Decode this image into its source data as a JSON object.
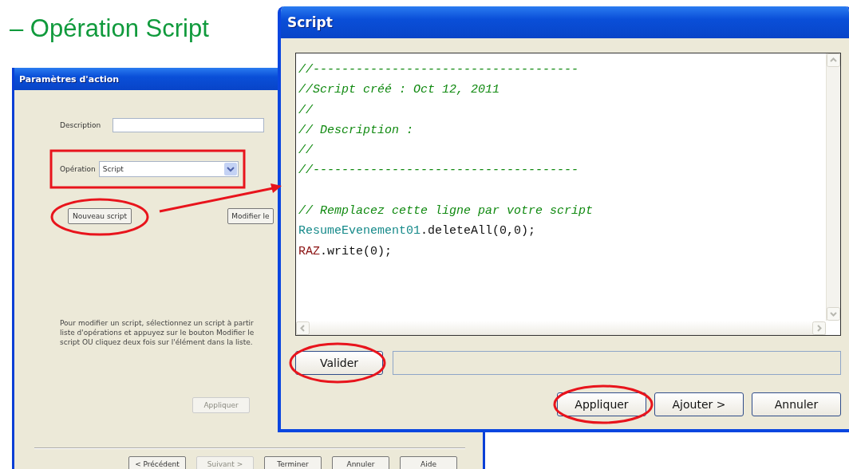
{
  "slide_title": "– Opération Script",
  "back_window": {
    "title": "Paramètres d'action",
    "description_label": "Description",
    "operation_label": "Opération",
    "operation_value": "Script",
    "action_buttons": [
      {
        "label": "Nouveau script",
        "disabled": false
      },
      {
        "label": "Modifier le",
        "disabled": false
      }
    ],
    "help_lines": [
      "Pour modifier un script, sélectionnez un script à partir",
      "liste d'opérations et appuyez sur le bouton Modifier le",
      "script OU cliquez deux fois sur l'élément dans la liste."
    ],
    "group_buttons": [
      {
        "label": "Appliquer",
        "disabled": true
      }
    ],
    "footer_buttons": [
      {
        "label": "< Précédent",
        "disabled": false
      },
      {
        "label": "Suivant >",
        "disabled": true
      },
      {
        "label": "Terminer",
        "disabled": false
      },
      {
        "label": "Annuler",
        "disabled": false
      },
      {
        "label": "Aide",
        "disabled": false
      }
    ]
  },
  "script_window": {
    "title": "Script",
    "code_lines": [
      {
        "kind": "code",
        "segments": [
          {
            "kind": "comment",
            "text": "//-------------------------------------"
          }
        ]
      },
      {
        "kind": "code",
        "segments": [
          {
            "kind": "comment",
            "text": "//Script créé : Oct 12, 2011"
          }
        ]
      },
      {
        "kind": "code",
        "segments": [
          {
            "kind": "comment",
            "text": "//"
          }
        ]
      },
      {
        "kind": "code",
        "segments": [
          {
            "kind": "comment",
            "text": "// Description :"
          }
        ]
      },
      {
        "kind": "code",
        "segments": [
          {
            "kind": "comment",
            "text": "//"
          }
        ]
      },
      {
        "kind": "code",
        "segments": [
          {
            "kind": "comment",
            "text": "//-------------------------------------"
          }
        ]
      },
      {
        "kind": "blank"
      },
      {
        "kind": "code",
        "segments": [
          {
            "kind": "comment",
            "text": "// Remplacez cette ligne par votre script"
          }
        ]
      },
      {
        "kind": "code",
        "segments": [
          {
            "kind": "object",
            "text": "ResumeEvenement01"
          },
          {
            "kind": "plain",
            "text": ".deleteAll(0,0);"
          }
        ]
      },
      {
        "kind": "code",
        "segments": [
          {
            "kind": "variable",
            "text": "RAZ"
          },
          {
            "kind": "plain",
            "text": ".write(0);"
          }
        ]
      }
    ],
    "validate_button": "Valider",
    "buttons": [
      {
        "label": "Appliquer"
      },
      {
        "label": "Ajouter >"
      },
      {
        "label": "Annuler"
      }
    ]
  }
}
